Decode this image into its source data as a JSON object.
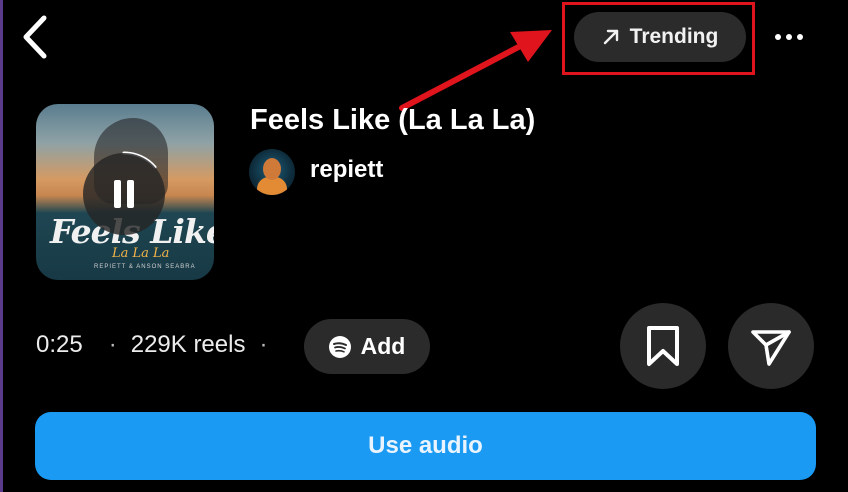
{
  "header": {
    "back_icon": "chevron-left-icon",
    "trending_label": "Trending",
    "trending_icon": "arrow-up-right-icon",
    "more_icon": "more-horizontal-icon",
    "annotation_color": "#e0141c"
  },
  "track": {
    "cover_title": "Feels Like",
    "cover_subtitle": "La La La",
    "cover_credit": "REPIETT & ANSON SEABRA",
    "title": "Feels Like (La La La)",
    "artist": "repiett",
    "duration": "0:25",
    "reels_count": "229K reels",
    "separator": "·"
  },
  "actions": {
    "add_label": "Add",
    "add_icon": "spotify-icon",
    "save_icon": "bookmark-icon",
    "share_icon": "send-icon",
    "use_audio_label": "Use audio",
    "accent_color": "#1a9af3"
  }
}
